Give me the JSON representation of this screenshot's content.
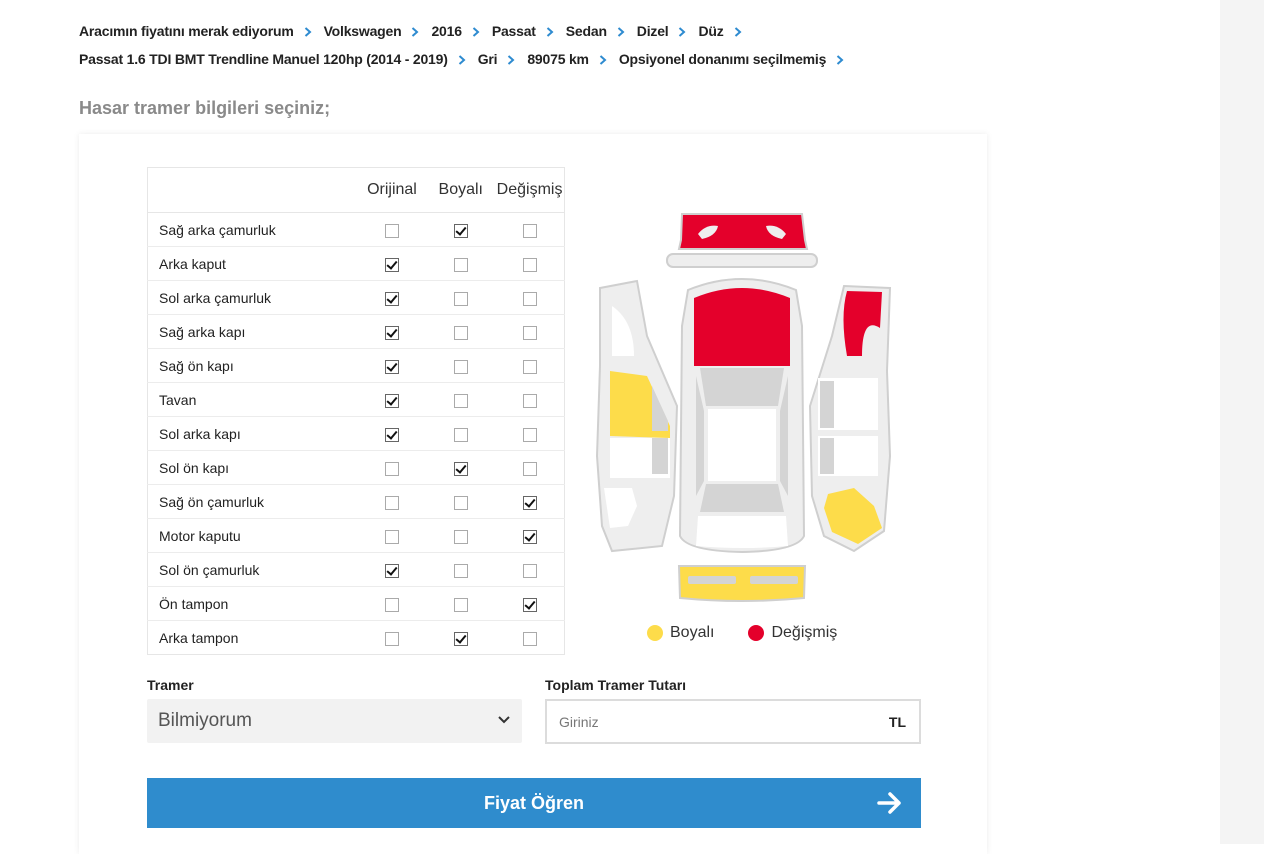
{
  "breadcrumbs": {
    "row1": [
      "Aracımın fiyatını merak ediyorum",
      "Volkswagen",
      "2016",
      "Passat",
      "Sedan",
      "Dizel",
      "Düz"
    ],
    "row2": [
      "Passat 1.6 TDI BMT Trendline Manuel 120hp (2014 - 2019)",
      "Gri",
      "89075 km",
      "Opsiyonel donanımı seçilmemiş"
    ]
  },
  "section_title": "Hasar tramer bilgileri seçiniz;",
  "table": {
    "columns": [
      "Orijinal",
      "Boyalı",
      "Değişmiş"
    ],
    "rows": [
      {
        "part": "Sağ arka çamurluk",
        "state": 1
      },
      {
        "part": "Arka kaput",
        "state": 0
      },
      {
        "part": "Sol arka çamurluk",
        "state": 0
      },
      {
        "part": "Sağ arka kapı",
        "state": 0
      },
      {
        "part": "Sağ ön kapı",
        "state": 0
      },
      {
        "part": "Tavan",
        "state": 0
      },
      {
        "part": "Sol arka kapı",
        "state": 0
      },
      {
        "part": "Sol ön kapı",
        "state": 1
      },
      {
        "part": "Sağ ön çamurluk",
        "state": 2
      },
      {
        "part": "Motor kaputu",
        "state": 2
      },
      {
        "part": "Sol ön çamurluk",
        "state": 0
      },
      {
        "part": "Ön tampon",
        "state": 2
      },
      {
        "part": "Arka tampon",
        "state": 1
      }
    ]
  },
  "legend": {
    "painted": "Boyalı",
    "replaced": "Değişmiş",
    "painted_color": "#fddc4a",
    "replaced_color": "#e4002b"
  },
  "tramer": {
    "label": "Tramer",
    "selected": "Bilmiyorum"
  },
  "total": {
    "label": "Toplam Tramer Tutarı",
    "placeholder": "Giriniz",
    "unit": "TL"
  },
  "cta": {
    "label": "Fiyat Öğren"
  },
  "colors": {
    "accent": "#2f8ccd",
    "chevron": "#2e8bd0"
  }
}
